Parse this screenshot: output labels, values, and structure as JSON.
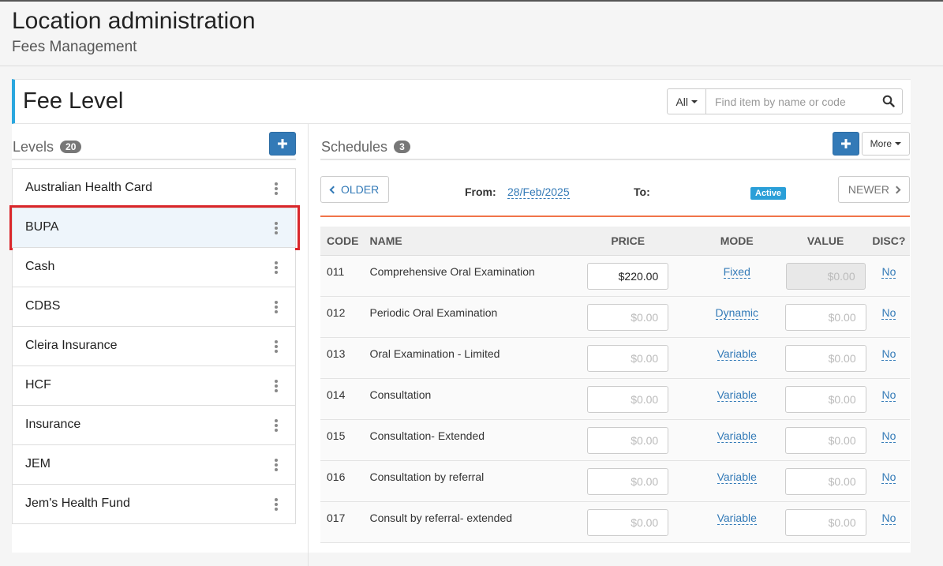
{
  "header": {
    "title": "Location administration",
    "subtitle": "Fees Management"
  },
  "panel": {
    "title": "Fee Level",
    "filter_label": "All",
    "search_placeholder": "Find item by name or code"
  },
  "levels": {
    "title": "Levels",
    "count": "20",
    "items": [
      {
        "label": "Australian Health Card"
      },
      {
        "label": "BUPA"
      },
      {
        "label": "Cash"
      },
      {
        "label": "CDBS"
      },
      {
        "label": "Cleira Insurance"
      },
      {
        "label": "HCF"
      },
      {
        "label": "Insurance"
      },
      {
        "label": "JEM"
      },
      {
        "label": "Jem's Health Fund"
      }
    ]
  },
  "schedules": {
    "title": "Schedules",
    "count": "3",
    "more_label": "More",
    "older_label": "OLDER",
    "newer_label": "NEWER",
    "from_label": "From:",
    "from_value": "28/Feb/2025",
    "to_label": "To:",
    "status": "Active",
    "columns": {
      "code": "CODE",
      "name": "NAME",
      "price": "PRICE",
      "mode": "MODE",
      "value": "VALUE",
      "disc": "DISC?"
    },
    "rows": [
      {
        "code": "011",
        "name": "Comprehensive Oral Examination",
        "price": "$220.00",
        "mode": "Fixed",
        "value": "$0.00",
        "disc": "No"
      },
      {
        "code": "012",
        "name": "Periodic Oral Examination",
        "price": "$0.00",
        "mode": "Dynamic",
        "value": "$0.00",
        "disc": "No"
      },
      {
        "code": "013",
        "name": "Oral Examination - Limited",
        "price": "$0.00",
        "mode": "Variable",
        "value": "$0.00",
        "disc": "No"
      },
      {
        "code": "014",
        "name": "Consultation",
        "price": "$0.00",
        "mode": "Variable",
        "value": "$0.00",
        "disc": "No"
      },
      {
        "code": "015",
        "name": "Consultation- Extended",
        "price": "$0.00",
        "mode": "Variable",
        "value": "$0.00",
        "disc": "No"
      },
      {
        "code": "016",
        "name": "Consultation by referral",
        "price": "$0.00",
        "mode": "Variable",
        "value": "$0.00",
        "disc": "No"
      },
      {
        "code": "017",
        "name": "Consult by referral- extended",
        "price": "$0.00",
        "mode": "Variable",
        "value": "$0.00",
        "disc": "No"
      }
    ]
  }
}
